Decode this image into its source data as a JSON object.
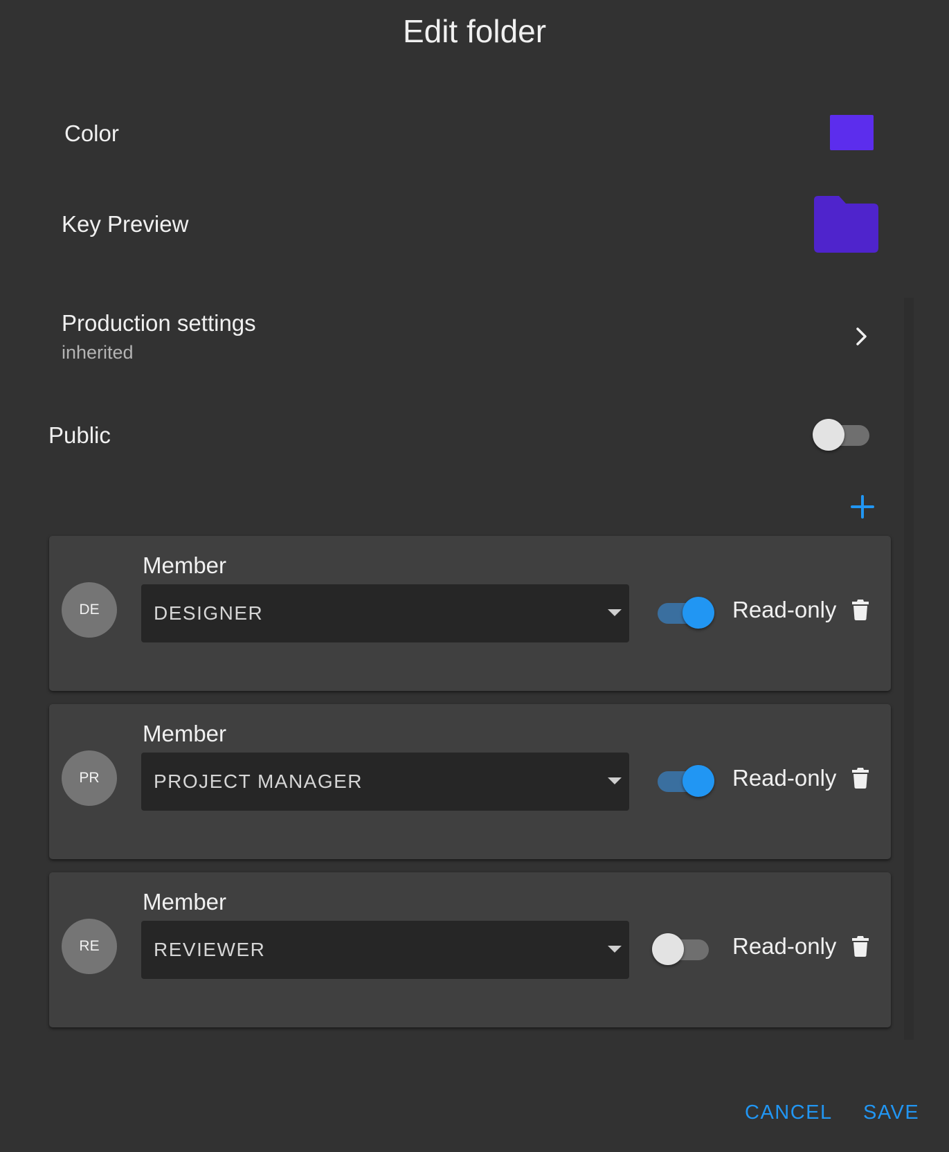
{
  "dialog": {
    "title": "Edit folder",
    "color": {
      "label": "Color",
      "value": "#5c2ded"
    },
    "key_preview": {
      "label": "Key Preview",
      "icon": "folder-icon",
      "icon_color": "#4f24cc"
    },
    "production_settings": {
      "label": "Production settings",
      "value": "inherited",
      "icon": "chevron-right-icon"
    },
    "public": {
      "label": "Public",
      "enabled": false
    },
    "add_member": {
      "icon": "plus-icon"
    },
    "members": [
      {
        "initials": "DE",
        "label": "Member",
        "role": "DESIGNER",
        "read_only_label": "Read-only",
        "read_only": true
      },
      {
        "initials": "PR",
        "label": "Member",
        "role": "PROJECT MANAGER",
        "read_only_label": "Read-only",
        "read_only": true
      },
      {
        "initials": "RE",
        "label": "Member",
        "role": "REVIEWER",
        "read_only_label": "Read-only",
        "read_only": false
      }
    ],
    "actions": {
      "cancel": "CANCEL",
      "save": "SAVE"
    },
    "accent_color": "#2196f3"
  }
}
